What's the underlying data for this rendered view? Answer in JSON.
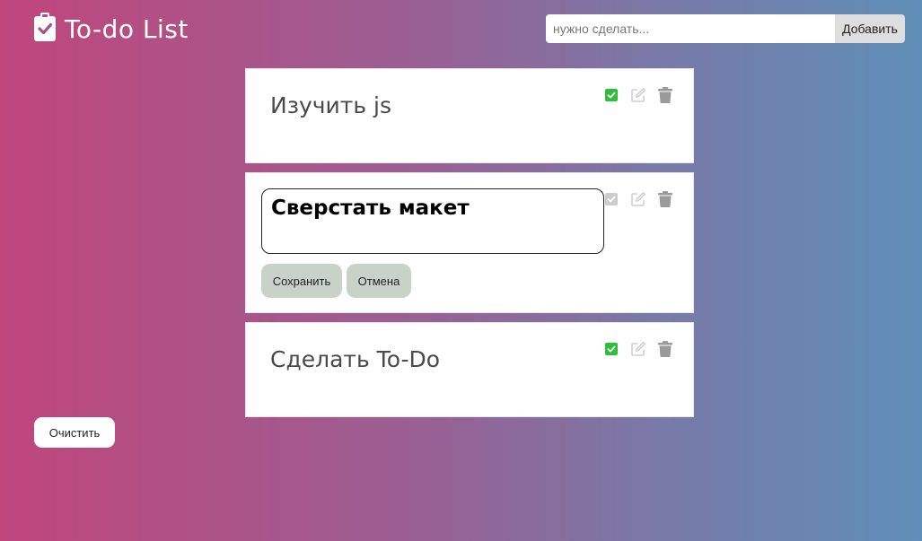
{
  "header": {
    "title": "To-do List",
    "icon": "clipboard-check-icon"
  },
  "add_form": {
    "placeholder": "нужно сделать...",
    "value": "",
    "button_label": "Добавить"
  },
  "tasks": [
    {
      "text": "Изучить js",
      "done": true,
      "editing": false
    },
    {
      "text": "Сверстать макет",
      "done": false,
      "editing": true
    },
    {
      "text": "Сделать To-Do",
      "done": true,
      "editing": false
    }
  ],
  "edit_controls": {
    "save_label": "Сохранить",
    "cancel_label": "Отмена"
  },
  "clear_label": "Очистить",
  "colors": {
    "check_active": "#2ebf3a",
    "check_inactive": "#cccccc",
    "icon_gray": "#9a9a9a",
    "icon_light": "#cfcfcf",
    "button_green": "#c9d2c9"
  }
}
